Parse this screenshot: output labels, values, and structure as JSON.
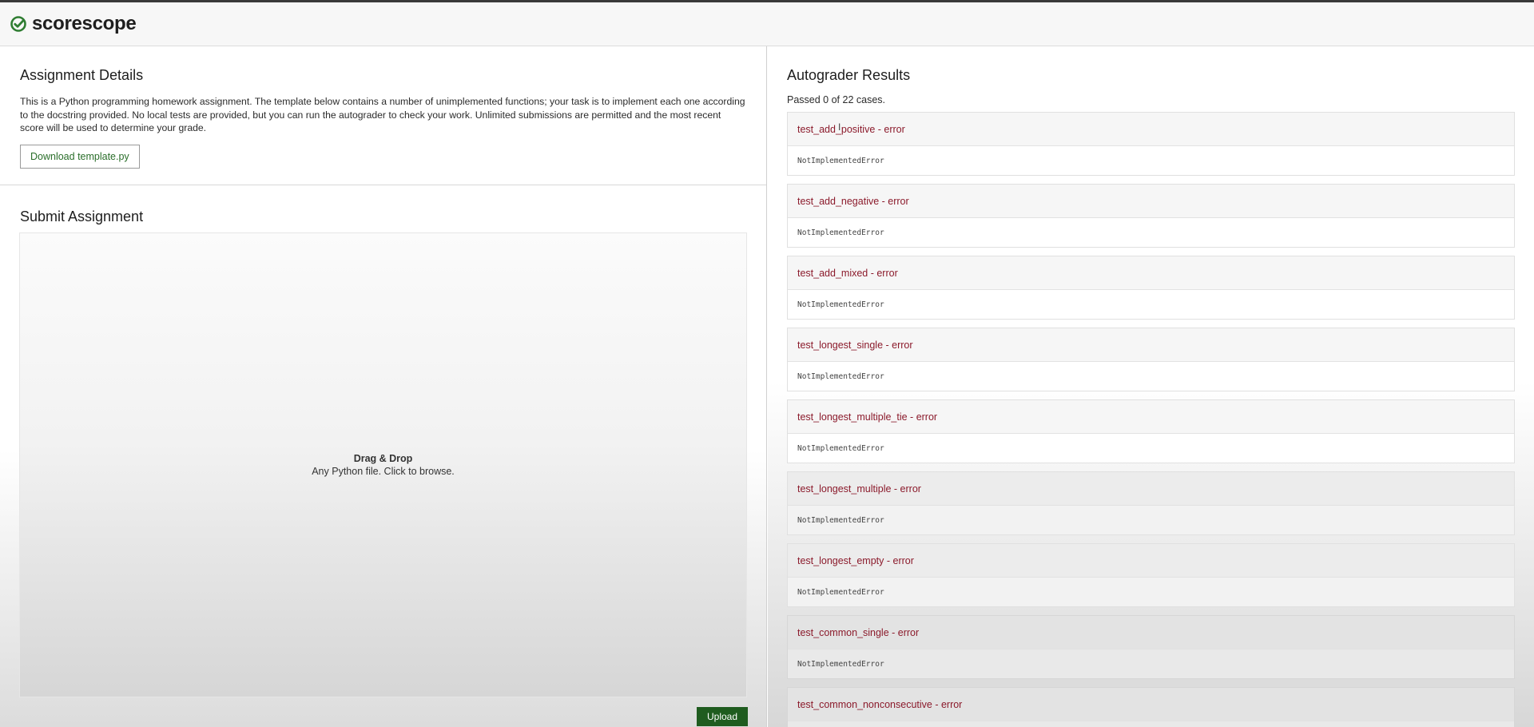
{
  "app": {
    "name": "scorescope",
    "logo_icon": "check-circle-icon",
    "brand_color": "#2f7d32"
  },
  "details": {
    "title": "Assignment Details",
    "description": "This is a Python programming homework assignment. The template below contains a number of unimplemented functions; your task is to implement each one according to the docstring provided. No local tests are provided, but you can run the autograder to check your work. Unlimited submissions are permitted and the most recent score will be used to determine your grade.",
    "download_label": "Download template.py"
  },
  "submit": {
    "title": "Submit Assignment",
    "dropzone_title": "Drag & Drop",
    "dropzone_subtitle": "Any Python file. Click to browse.",
    "upload_label": "Upload"
  },
  "results": {
    "title": "Autograder Results",
    "summary": "Passed 0 of 22 cases.",
    "cases": [
      {
        "name": "test_add_positive - error",
        "message": "NotImplementedError"
      },
      {
        "name": "test_add_negative - error",
        "message": "NotImplementedError"
      },
      {
        "name": "test_add_mixed - error",
        "message": "NotImplementedError"
      },
      {
        "name": "test_longest_single - error",
        "message": "NotImplementedError"
      },
      {
        "name": "test_longest_multiple_tie - error",
        "message": "NotImplementedError"
      },
      {
        "name": "test_longest_multiple - error",
        "message": "NotImplementedError"
      },
      {
        "name": "test_longest_empty - error",
        "message": "NotImplementedError"
      },
      {
        "name": "test_common_single - error",
        "message": "NotImplementedError"
      },
      {
        "name": "test_common_nonconsecutive - error",
        "message": ""
      }
    ]
  },
  "colors": {
    "error_text": "#8b1a2b",
    "upload_button": "#1f5c1f",
    "download_text": "#2a6e2a"
  }
}
